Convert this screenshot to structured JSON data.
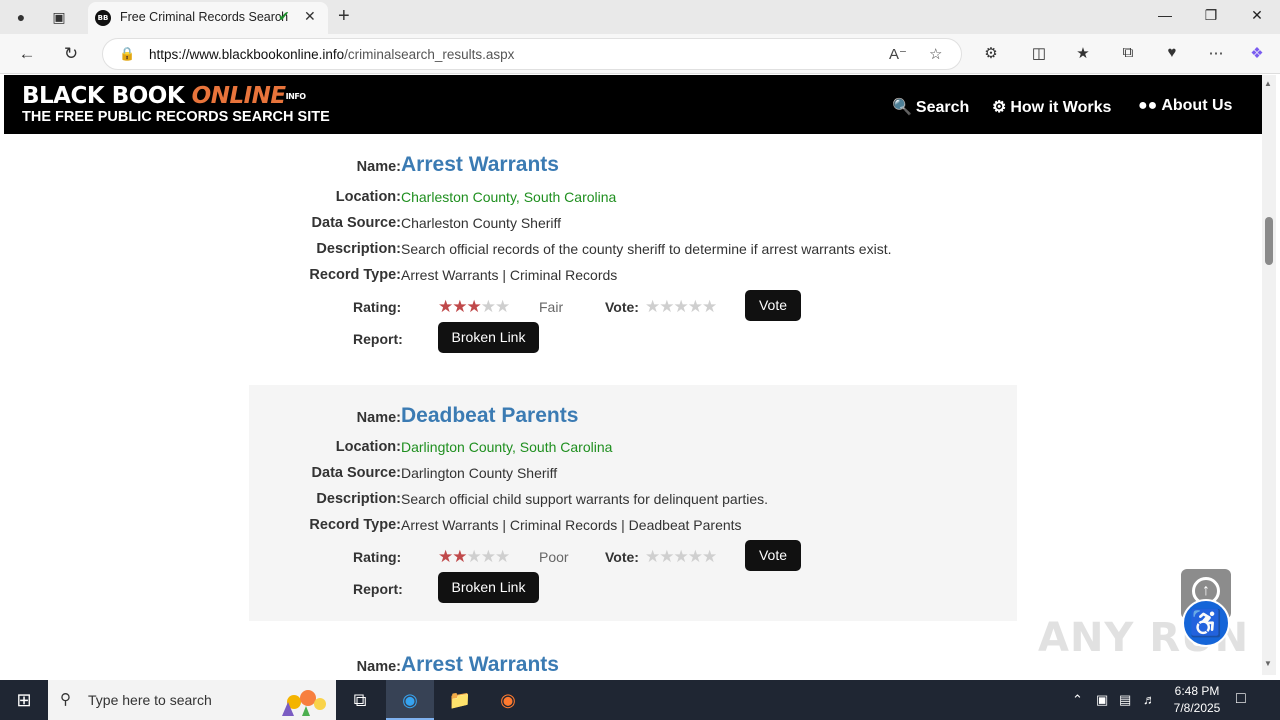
{
  "browser": {
    "tab_title": "Free Criminal Records Search",
    "url_domain": "https://www.blackbookonline.info",
    "url_path": "/criminalsearch_results.aspx"
  },
  "site": {
    "logo_black_book": "BLACK BOOK ",
    "logo_online": "ONLINE",
    "logo_info": "INFO",
    "tagline": "THE FREE PUBLIC RECORDS SEARCH SITE",
    "nav": {
      "search": "Search",
      "how_it_works": "How it Works",
      "about_us": "About Us"
    }
  },
  "labels": {
    "name": "Name:",
    "location": "Location:",
    "data_source": "Data Source:",
    "description": "Description:",
    "record_type": "Record Type:",
    "rating": "Rating:",
    "vote": "Vote:",
    "report": "Report:",
    "vote_button": "Vote",
    "broken_link_button": "Broken Link"
  },
  "records": [
    {
      "name": "Arrest Warrants",
      "location": "Charleston County, South Carolina",
      "data_source": "Charleston County Sheriff",
      "description": "Search official records of the county sheriff to determine if arrest warrants exist.",
      "record_type": "Arrest Warrants | Criminal Records",
      "rating_stars": 3,
      "rating_word": "Fair"
    },
    {
      "name": "Deadbeat Parents",
      "location": "Darlington County, South Carolina",
      "data_source": "Darlington County Sheriff",
      "description": "Search official child support warrants for delinquent parties.",
      "record_type": "Arrest Warrants | Criminal Records | Deadbeat Parents",
      "rating_stars": 2,
      "rating_word": "Poor"
    },
    {
      "name": "Arrest Warrants"
    }
  ],
  "watermark": "ANY RUN",
  "taskbar": {
    "search_placeholder": "Type here to search",
    "time": "6:48 PM",
    "date": "7/8/2025"
  }
}
